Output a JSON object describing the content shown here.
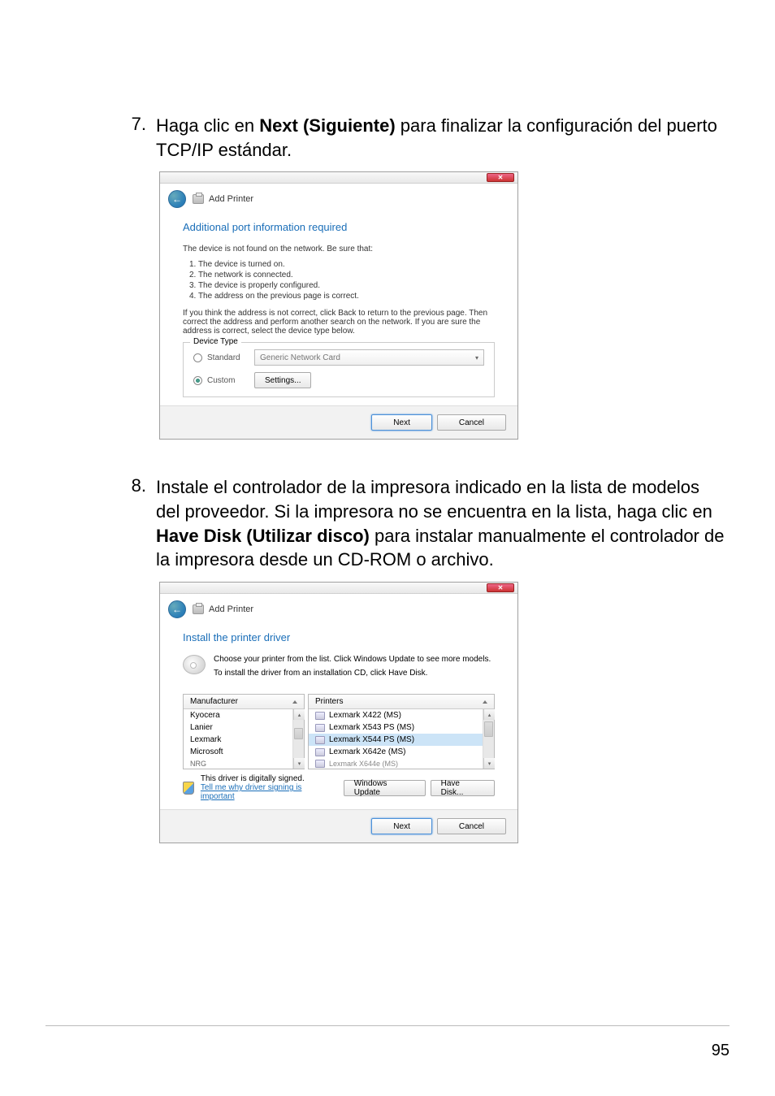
{
  "page_number": "95",
  "steps": [
    {
      "num": "7.",
      "pre": "Haga clic en ",
      "bold": "Next (Siguiente)",
      "post": " para finalizar la configuración del puerto TCP/IP estándar."
    },
    {
      "num": "8.",
      "pre": "Instale el controlador de la impresora indicado en la lista de modelos del proveedor. Si la impresora no se encuentra en la lista, haga clic en ",
      "bold": "Have Disk (Utilizar disco)",
      "post": " para instalar manualmente el controlador de la impresora desde un CD-ROM o archivo."
    }
  ],
  "dialog1": {
    "window_title": "Add Printer",
    "heading": "Additional port information required",
    "not_found": "The device is not found on the network.  Be sure that:",
    "checks": [
      "1.   The device is turned on.",
      "2.   The network is connected.",
      "3.   The device is properly configured.",
      "4.   The address on the previous page is correct."
    ],
    "hint": "If you think the address is not correct, click Back to return to the previous page.  Then correct the address and perform another search on the network.  If you are sure the address is correct, select the device type below.",
    "fieldset_label": "Device Type",
    "radio_standard": "Standard",
    "combo_value": "Generic Network Card",
    "radio_custom": "Custom",
    "settings_btn": "Settings...",
    "next_btn": "Next",
    "cancel_btn": "Cancel"
  },
  "dialog2": {
    "window_title": "Add Printer",
    "heading": "Install the printer driver",
    "instr1": "Choose your printer from the list. Click Windows Update to see more models.",
    "instr2": "To install the driver from an installation CD, click Have Disk.",
    "col_manufacturer": "Manufacturer",
    "col_printers": "Printers",
    "manufacturers": [
      "Kyocera",
      "Lanier",
      "Lexmark",
      "Microsoft",
      "NRG"
    ],
    "printers": [
      "Lexmark X422 (MS)",
      "Lexmark X543 PS (MS)",
      "Lexmark X544 PS (MS)",
      "Lexmark X642e (MS)",
      "Lexmark X644e (MS)"
    ],
    "selected_printer_index": 2,
    "signed_text": "This driver is digitally signed.",
    "signed_link": "Tell me why driver signing is important",
    "win_update_btn": "Windows Update",
    "have_disk_btn": "Have Disk...",
    "next_btn": "Next",
    "cancel_btn": "Cancel"
  }
}
